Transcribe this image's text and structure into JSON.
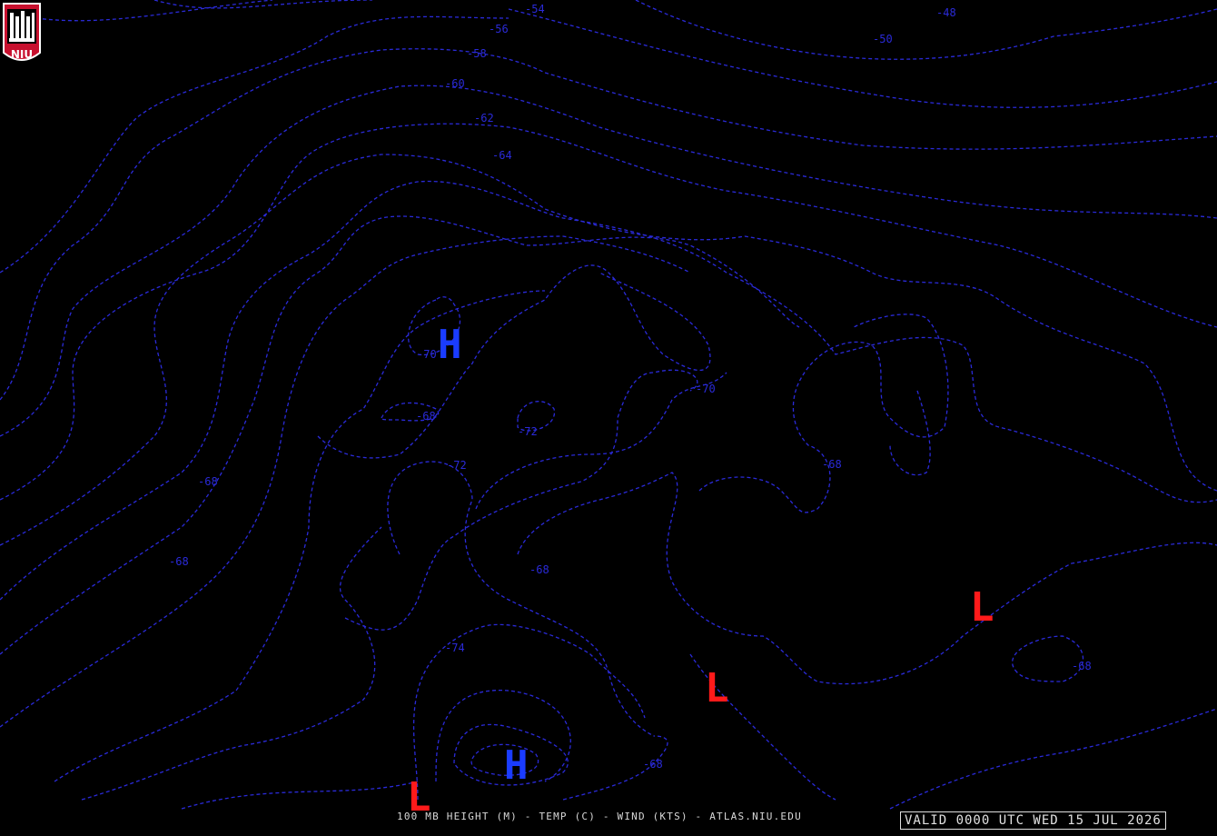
{
  "logo": {
    "text": "NIU",
    "colors": {
      "red": "#c8102e",
      "white": "#ffffff"
    }
  },
  "caption": "100 MB HEIGHT (M) - TEMP (C) - WIND (KTS) - ATLAS.NIU.EDU",
  "valid_time": "VALID 0000 UTC WED 15 JUL 2026",
  "colors": {
    "background": "#000000",
    "isotherm": "#2a2ad8",
    "high": "#1a3cff",
    "low": "#ff1a1a",
    "text": "#d8d8d8"
  },
  "contour_labels": {
    "t54": "-54",
    "t48": "-48",
    "t50": "-50",
    "t56": "-56",
    "t58": "-58",
    "t60": "-60",
    "t62": "-62",
    "t64": "-64",
    "t70a": "-70",
    "t70b": "-70",
    "t68a": "-68",
    "t72a": "-72",
    "t72b": "-72",
    "t68b": "-68",
    "t66a": "-68",
    "t68c": "-68",
    "t68d": "-68",
    "t74": "-74",
    "t68e": "-68",
    "t68f": "-68"
  },
  "pressure_centers": {
    "high1": "H",
    "high2": "H",
    "low1": "L",
    "low2": "L",
    "low3": "L"
  }
}
